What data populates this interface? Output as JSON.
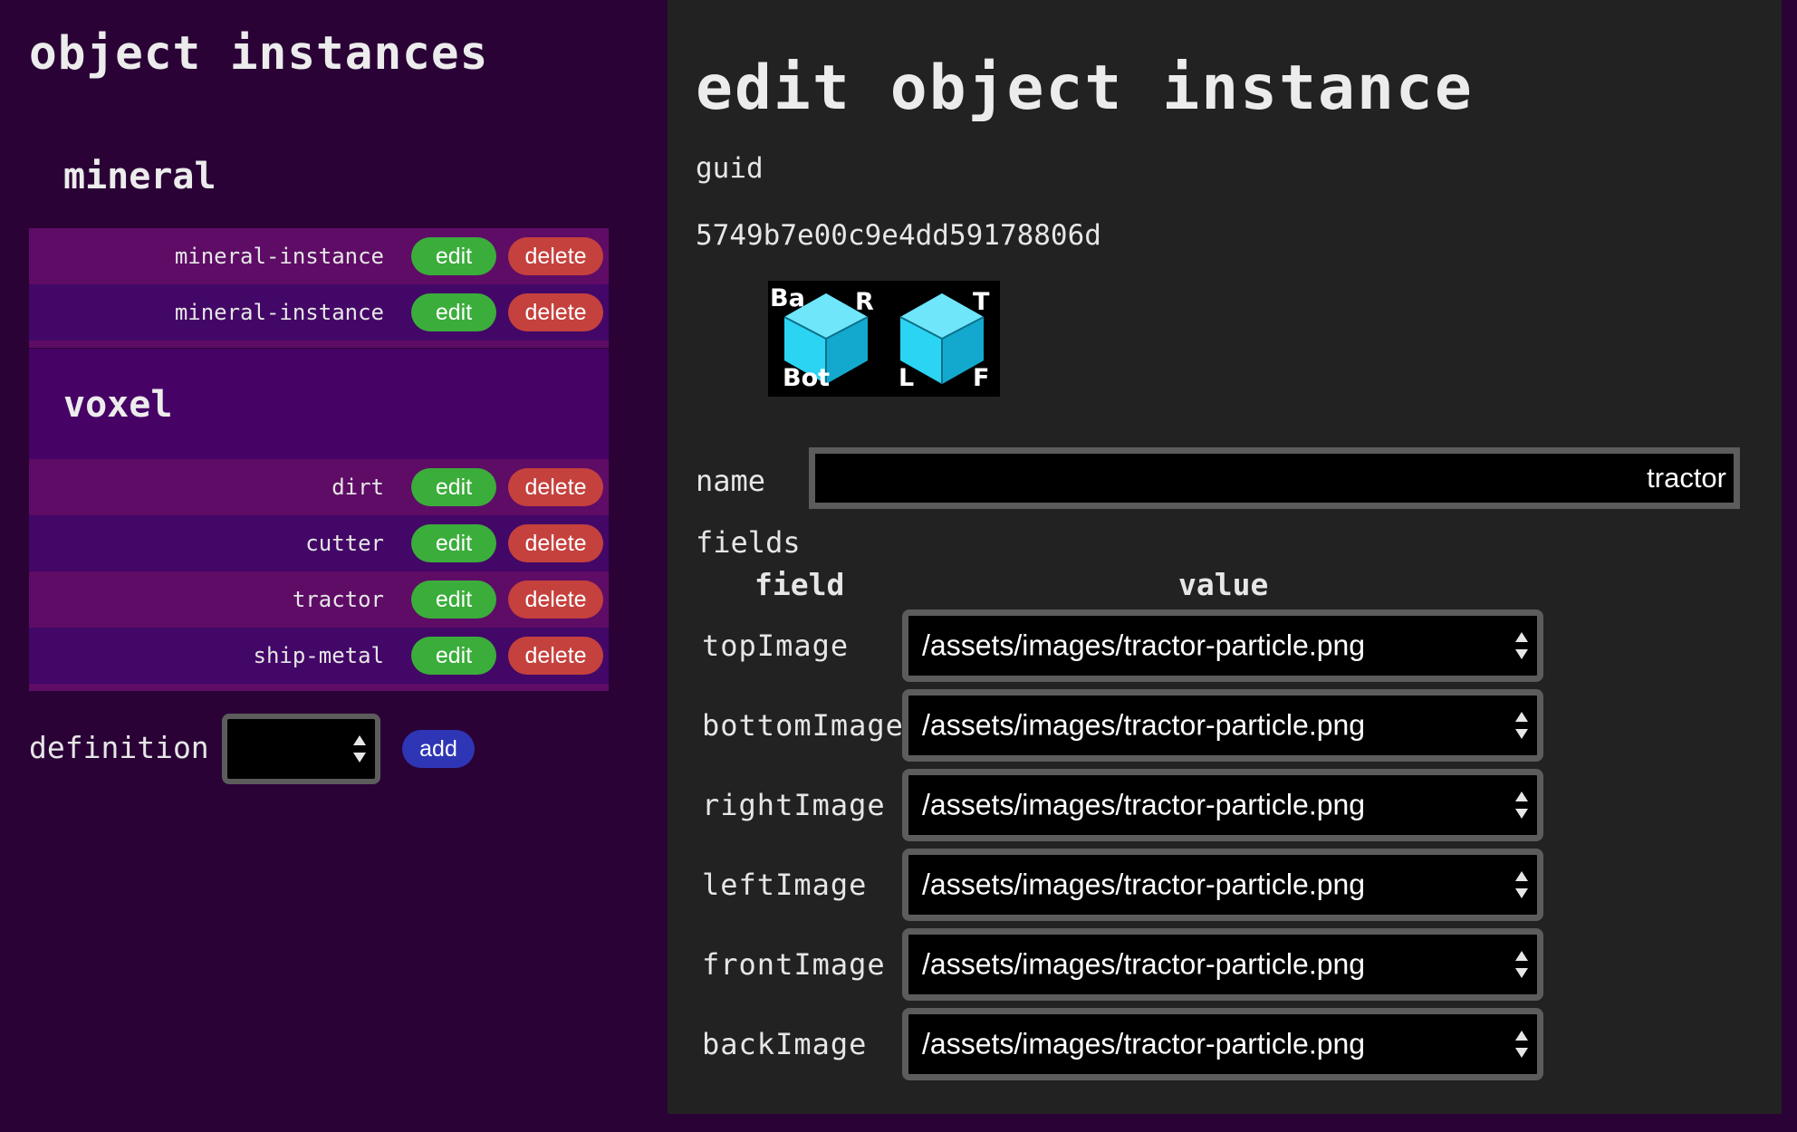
{
  "sidebar": {
    "title": "object instances",
    "groups": [
      {
        "name": "mineral",
        "items": [
          {
            "label": "mineral-instance"
          },
          {
            "label": "mineral-instance"
          }
        ]
      },
      {
        "name": "voxel",
        "items": [
          {
            "label": "dirt"
          },
          {
            "label": "cutter"
          },
          {
            "label": "tractor"
          },
          {
            "label": "ship-metal"
          }
        ]
      }
    ],
    "edit_label": "edit",
    "delete_label": "delete",
    "definition_label": "definition",
    "definition_value": "",
    "add_label": "add"
  },
  "main": {
    "title": "edit object instance",
    "guid_label": "guid",
    "guid_value": "5749b7e00c9e4dd59178806d",
    "preview": {
      "cube_left_labels": [
        "Ba",
        "R",
        "Bot"
      ],
      "cube_right_labels": [
        "T",
        "L",
        "F"
      ]
    },
    "name_label": "name",
    "name_value": "tractor",
    "fields_label": "fields",
    "column_field": "field",
    "column_value": "value",
    "fields": [
      {
        "field": "topImage",
        "value": "/assets/images/tractor-particle.png"
      },
      {
        "field": "bottomImage",
        "value": "/assets/images/tractor-particle.png"
      },
      {
        "field": "rightImage",
        "value": "/assets/images/tractor-particle.png"
      },
      {
        "field": "leftImage",
        "value": "/assets/images/tractor-particle.png"
      },
      {
        "field": "frontImage",
        "value": "/assets/images/tractor-particle.png"
      },
      {
        "field": "backImage",
        "value": "/assets/images/tractor-particle.png"
      }
    ]
  },
  "colors": {
    "sidebar_bg": "#2a0236",
    "main_bg": "#222222",
    "edit_button": "#3bad3b",
    "delete_button": "#c5413d",
    "add_button": "#2e36b5",
    "cube": "#2ad4f2"
  },
  "icons": {
    "select_arrows": "updown-arrows-icon"
  }
}
